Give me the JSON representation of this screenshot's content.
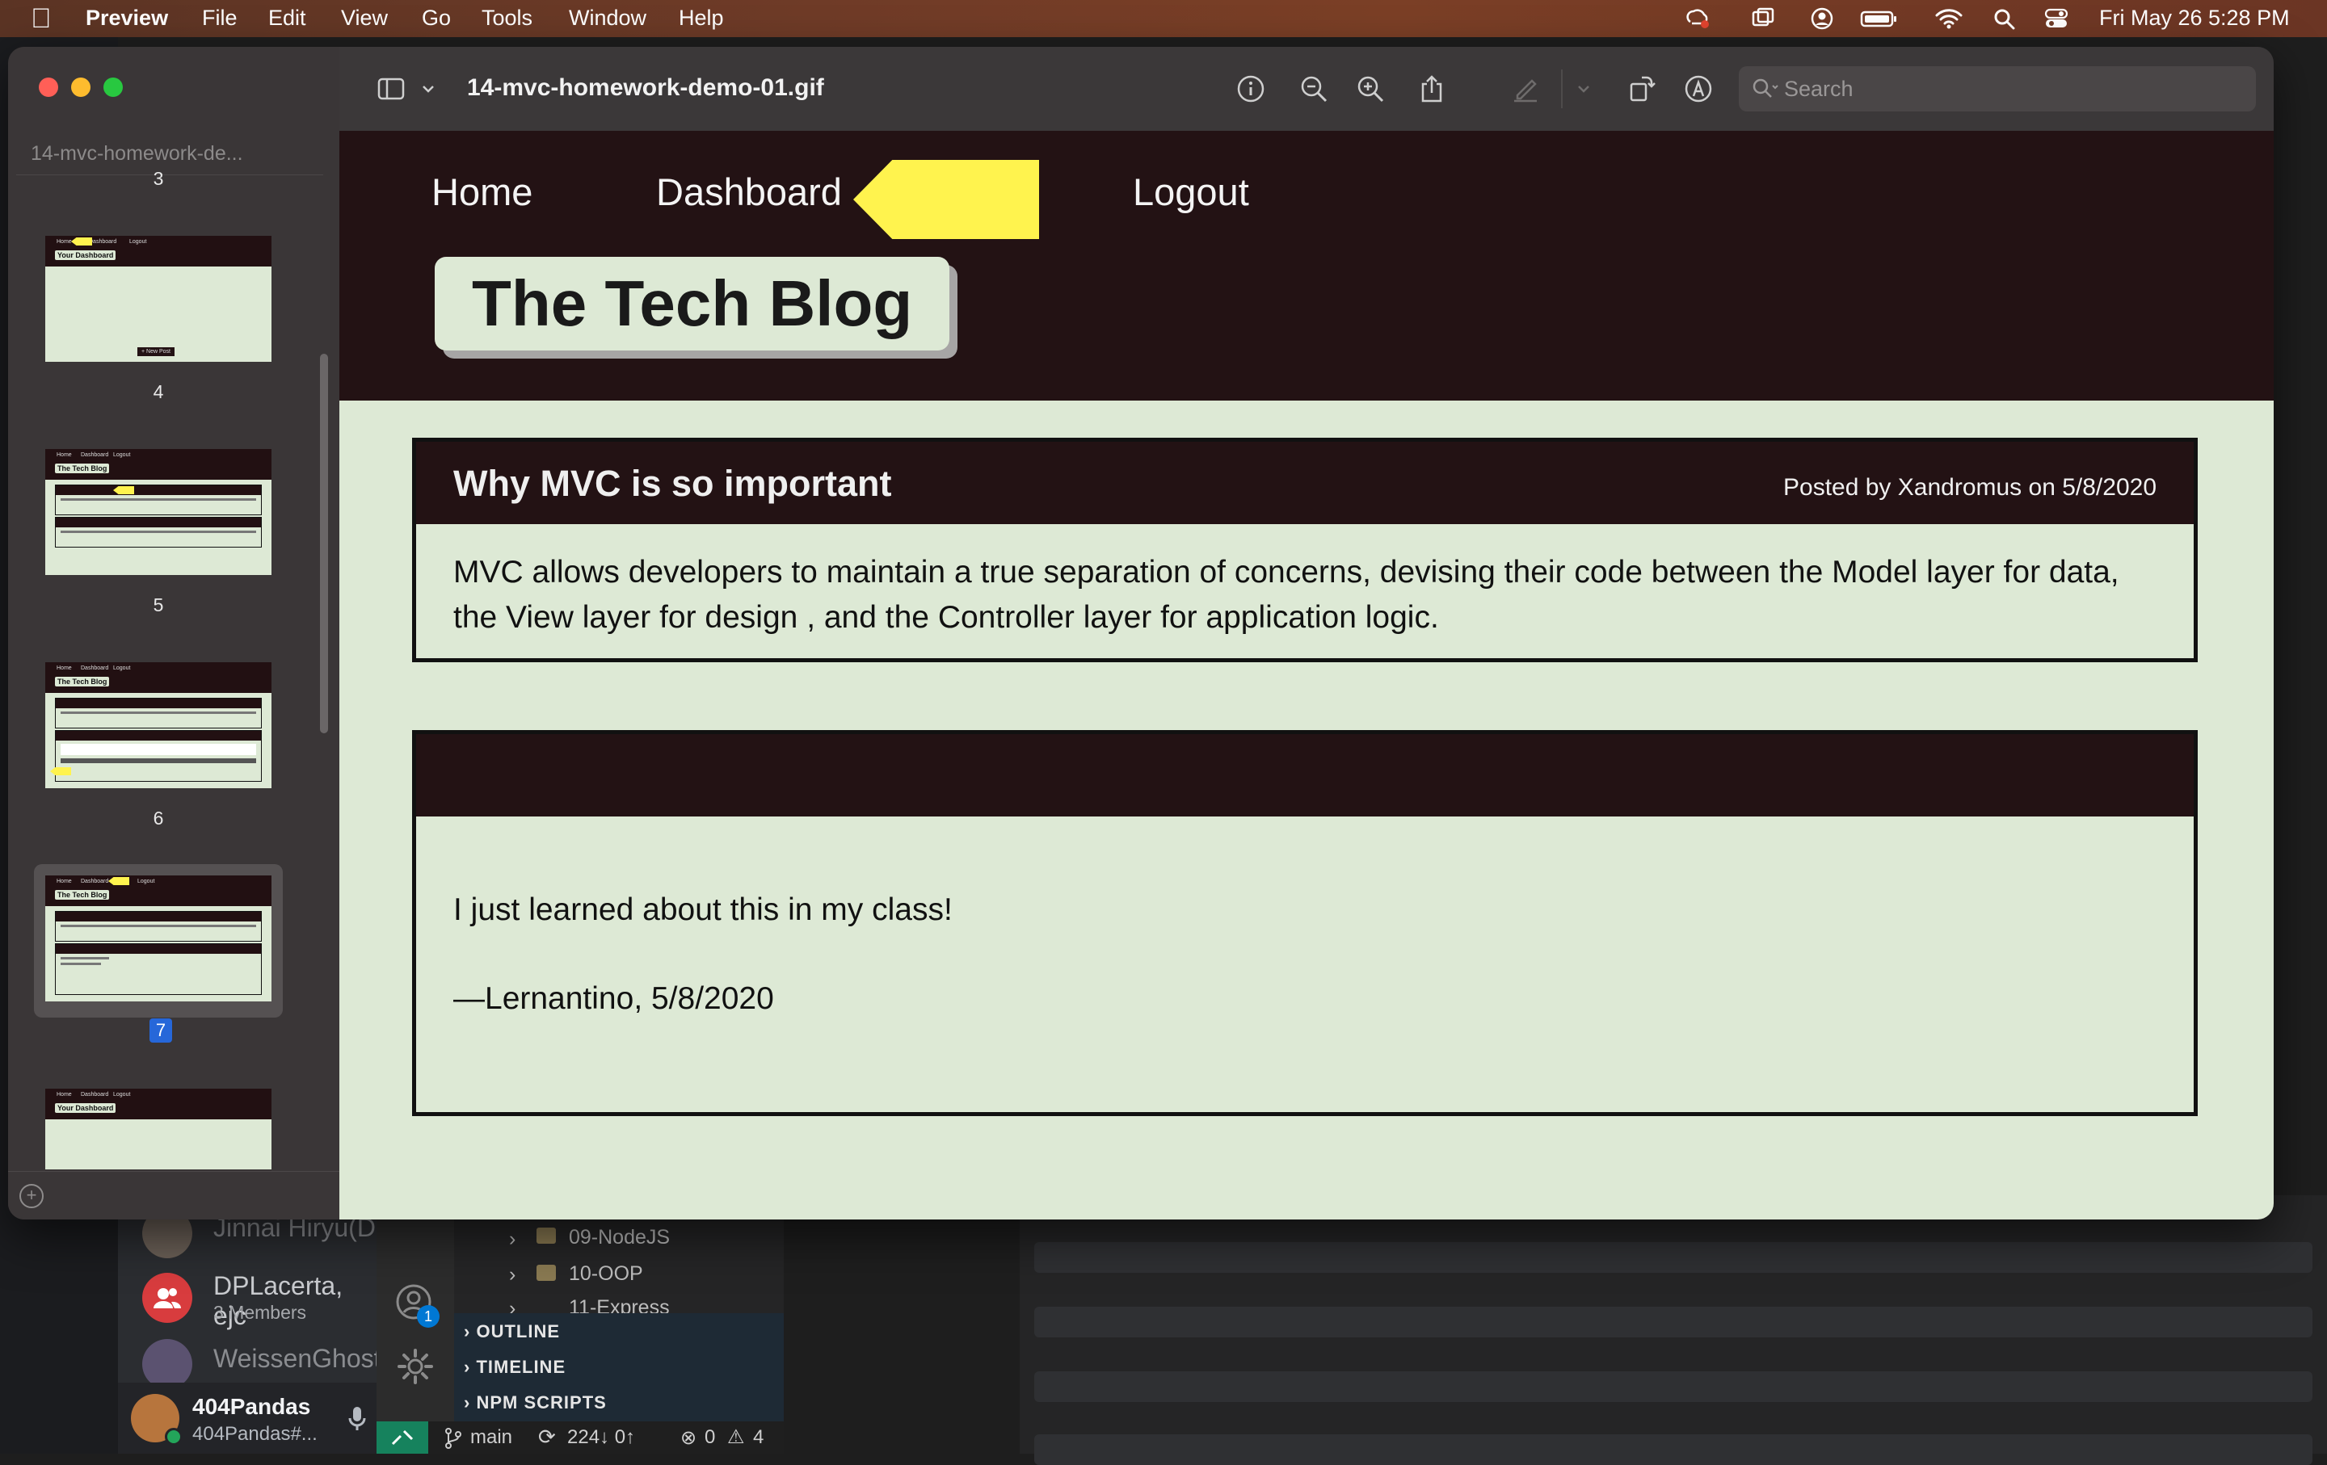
{
  "menubar": {
    "app": "Preview",
    "items": [
      "File",
      "Edit",
      "View",
      "Go",
      "Tools",
      "Window",
      "Help"
    ],
    "datetime": "Fri May 26  5:28 PM"
  },
  "background": {
    "discord": {
      "item1": "Jinnai Hiryu(D",
      "item2_name": "DPLacerta, ejc",
      "item2_sub": "3 Members",
      "item3": "WeissenGhost",
      "user_name": "404Pandas",
      "user_tag": "404Pandas#..."
    },
    "explorer": {
      "folders": [
        "09-NodeJS",
        "10-OOP",
        "11-Express"
      ],
      "sections": [
        "OUTLINE",
        "TIMELINE",
        "NPM SCRIPTS"
      ],
      "accounts_badge": "1"
    },
    "statusbar": {
      "branch": "main",
      "sync": "224↓ 0↑",
      "errors": "0",
      "warnings": "4"
    }
  },
  "preview": {
    "sidebar_title": "14-mvc-homework-de...",
    "pages": [
      "3",
      "4",
      "5",
      "6",
      "7"
    ],
    "selected_page": "7",
    "doc_title": "14-mvc-homework-demo-01.gif",
    "search_placeholder": "Search",
    "thumb_labels": {
      "home": "Home",
      "dashboard": "Dashboard",
      "logout": "Logout",
      "your_dashboard": "Your Dashboard",
      "tech_blog": "The Tech Blog",
      "new_post": "+ New Post"
    }
  },
  "site": {
    "nav": {
      "home": "Home",
      "dashboard": "Dashboard",
      "logout": "Logout"
    },
    "brand": "The Tech Blog",
    "post": {
      "title": "Why MVC is so important",
      "meta": "Posted by Xandromus on 5/8/2020",
      "body": "MVC allows developers to maintain a true separation of concerns, devising their code between the Model layer for data, the View layer for design , and the Controller layer for application logic."
    },
    "comment": {
      "text": "I just learned about this in my class!",
      "author": "—Lernantino, 5/8/2020"
    }
  },
  "colors": {
    "header_bg": "#231214",
    "page_bg": "#dde9d5",
    "arrow": "#fff34e",
    "selection": "#2667d9"
  }
}
